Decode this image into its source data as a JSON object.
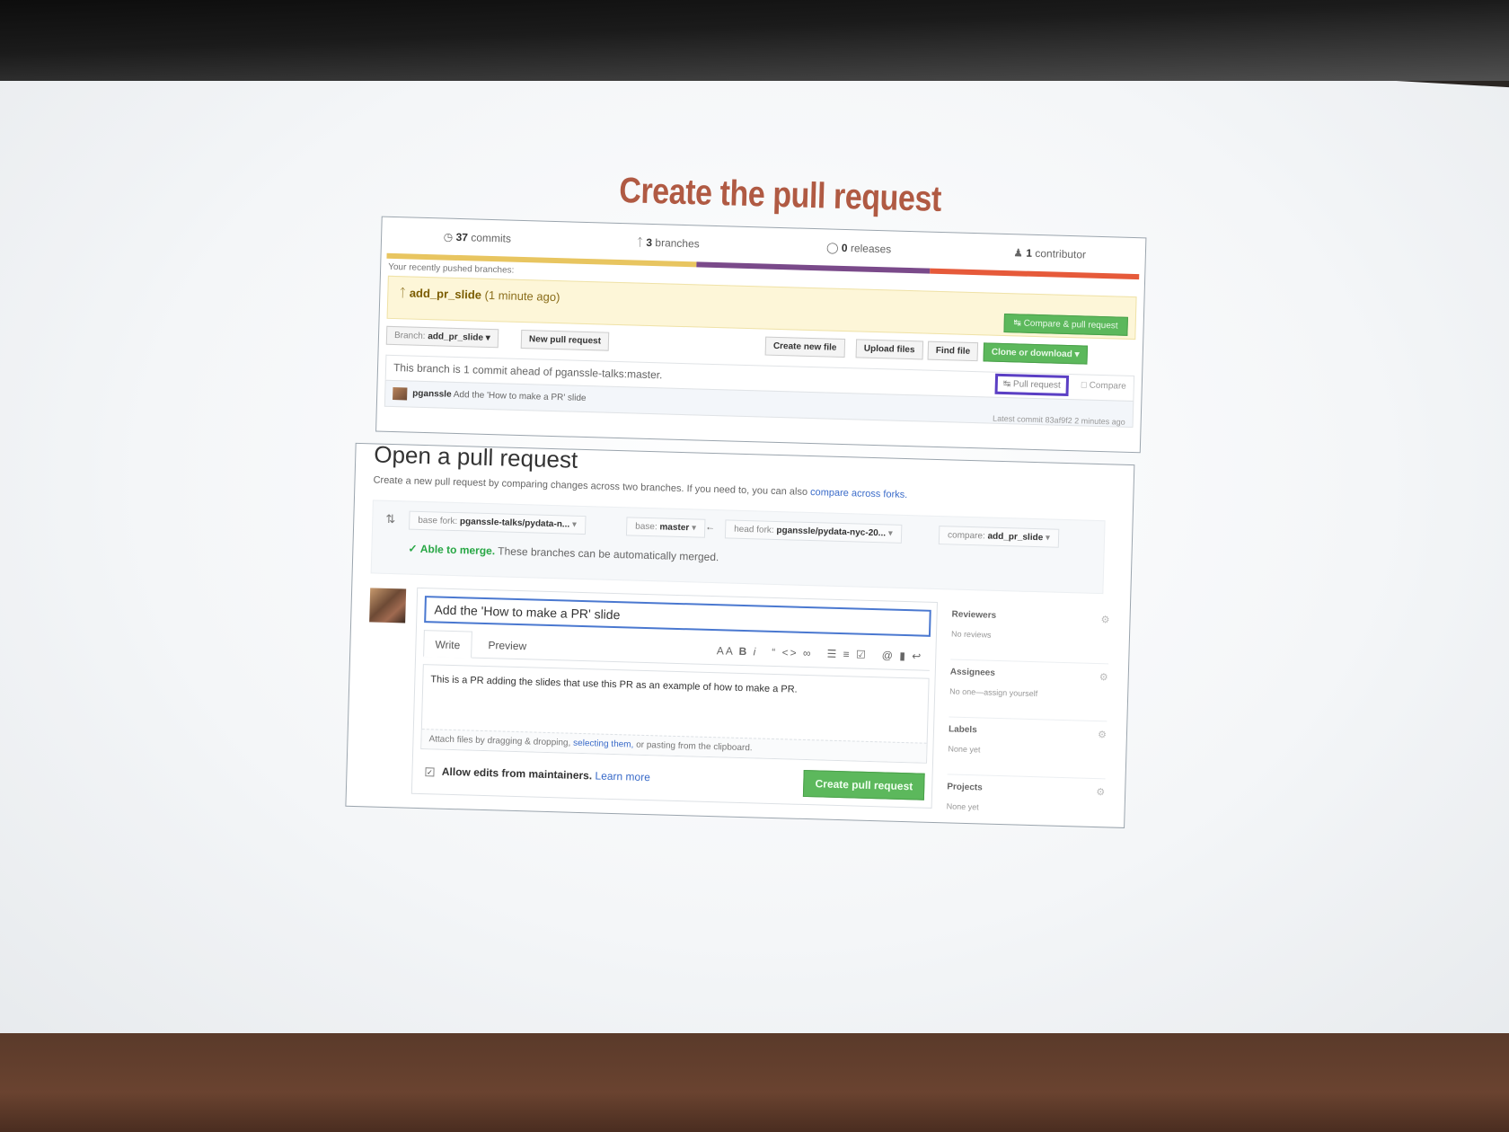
{
  "slide": {
    "title": "Create the pull request"
  },
  "repo": {
    "stats": {
      "commits_count": "37",
      "commits_label": "commits",
      "branches_count": "3",
      "branches_label": "branches",
      "releases_count": "0",
      "releases_label": "releases",
      "contributors_count": "1",
      "contributors_label": "contributor"
    },
    "language_colors": [
      "#e8c560",
      "#7a4a8a",
      "#e65a3a"
    ],
    "recent_label": "Your recently pushed branches:",
    "recent_branch": "add_pr_slide",
    "recent_time": "(1 minute ago)",
    "compare_button": "Compare & pull request",
    "branch_prefix": "Branch:",
    "branch_name": "add_pr_slide",
    "new_pr_button": "New pull request",
    "create_file_button": "Create new file",
    "upload_button": "Upload files",
    "find_button": "Find file",
    "clone_button": "Clone or download",
    "ahead_text": "This branch is 1 commit ahead of pganssle-talks:master.",
    "pull_request_link": "Pull request",
    "compare_link": "Compare",
    "commit_author": "pganssle",
    "commit_message": "Add the 'How to make a PR' slide",
    "latest_commit": "Latest commit 83af9f2 2 minutes ago"
  },
  "open_pr": {
    "title": "Open a pull request",
    "subtitle": "Create a new pull request by comparing changes across two branches. If you need to, you can also",
    "subtitle_link": "compare across forks.",
    "base_fork_label": "base fork:",
    "base_fork_value": "pganssle-talks/pydata-n...",
    "base_label": "base:",
    "base_value": "master",
    "head_fork_label": "head fork:",
    "head_fork_value": "pganssle/pydata-nyc-20...",
    "compare_label": "compare:",
    "compare_value": "add_pr_slide",
    "merge_status": "Able to merge.",
    "merge_text": "These branches can be automatically merged.",
    "pr_title_value": "Add the 'How to make a PR' slide",
    "tab_write": "Write",
    "tab_preview": "Preview",
    "body_text": "This is a PR adding the slides that use this PR as an example of how to make a PR.",
    "attach_prefix": "Attach files by dragging & dropping,",
    "attach_link": "selecting them,",
    "attach_suffix": "or pasting from the clipboard.",
    "allow_edits": "Allow edits from maintainers.",
    "learn_more": "Learn more",
    "create_button": "Create pull request",
    "sidebar": [
      {
        "heading": "Reviewers",
        "value": "No reviews"
      },
      {
        "heading": "Assignees",
        "value": "No one—assign yourself"
      },
      {
        "heading": "Labels",
        "value": "None yet"
      },
      {
        "heading": "Projects",
        "value": "None yet"
      }
    ]
  }
}
